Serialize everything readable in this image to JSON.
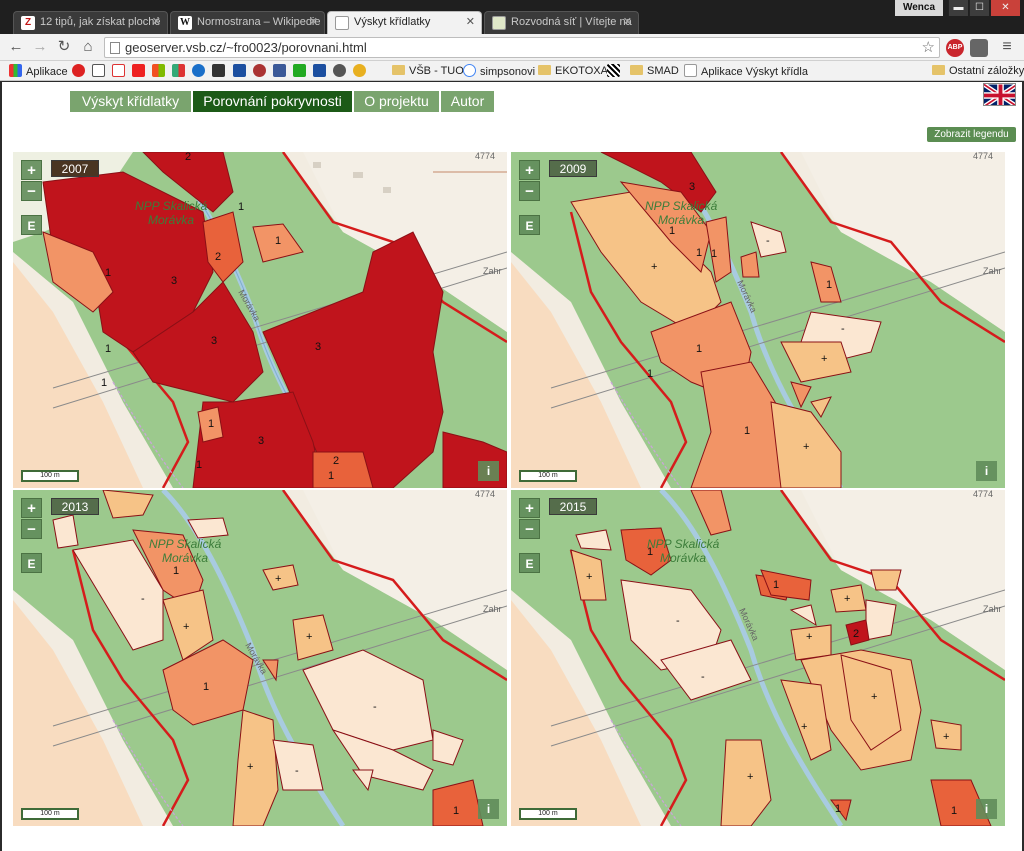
{
  "browser": {
    "tabs": [
      {
        "title": "12 tipů, jak získat ploché",
        "favicon": "Z",
        "active": false
      },
      {
        "title": "Normostrana – Wikipedie",
        "favicon": "W",
        "active": false
      },
      {
        "title": "Výskyt křídlatky",
        "favicon": "page",
        "active": true
      },
      {
        "title": "Rozvodná síť | Vítejte na",
        "favicon": "page",
        "active": false
      }
    ],
    "user": "Wenca",
    "window_buttons": {
      "minimize": "▬",
      "maximize": "☐",
      "close": "✕"
    },
    "url": "geoserver.vsb.cz/~fro0023/porovnani.html",
    "nav_icons": {
      "back": "←",
      "forward": "→",
      "reload": "↻",
      "home": "⌂",
      "star": "☆",
      "menu": "≡"
    },
    "extensions": {
      "abp": "ABP"
    },
    "bookmarks": [
      "Aplikace",
      "VŠB - TUO",
      "simpsonovi",
      "EKOTOXA",
      "SMAD",
      "Aplikace Výskyt křídla"
    ],
    "other_bookmarks": "Ostatní záložky"
  },
  "page": {
    "nav": [
      "Výskyt křídlatky",
      "Porovnání pokryvnosti",
      "O projektu",
      "Autor"
    ],
    "active_nav": 1,
    "legend_button": "Zobrazit legendu",
    "map_controls": {
      "zoom_in": "+",
      "zoom_out": "−",
      "edit": "E",
      "info": "i",
      "scale": "100 m"
    },
    "map_texts": {
      "place_name_1": "NPP Skalická",
      "place_name_2": "Morávka",
      "river": "Morávka",
      "village": "Zahr",
      "elevation": "4774"
    },
    "maps": [
      {
        "year": "2007"
      },
      {
        "year": "2009"
      },
      {
        "year": "2013"
      },
      {
        "year": "2015"
      }
    ]
  },
  "colors": {
    "class3": "#c0141c",
    "class2": "#e8623b",
    "class1": "#f29466",
    "plus": "#f6c387",
    "minus": "#fbe7d2",
    "forest": "#9cc98d",
    "nav_active": "#1c5a17",
    "nav_inactive": "#7aa46e"
  }
}
